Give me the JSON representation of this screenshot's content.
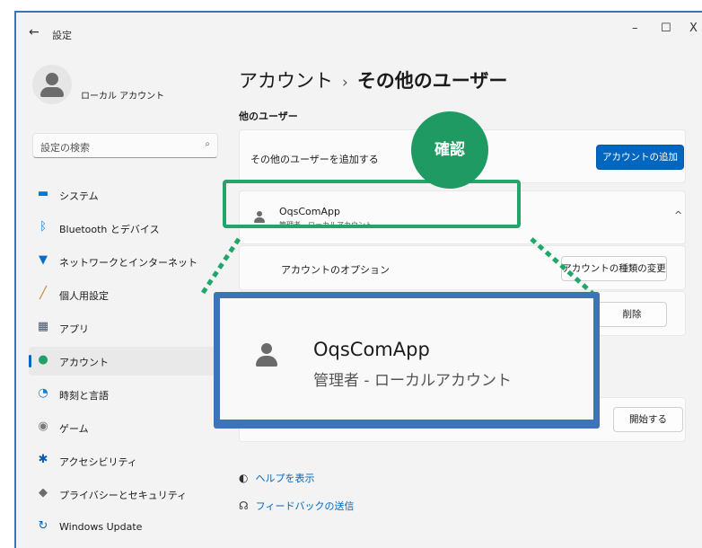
{
  "window": {
    "back_glyph": "←",
    "title": "設定",
    "minimize_glyph": "–",
    "maximize_glyph": "☐",
    "close_glyph": "X"
  },
  "user": {
    "name": "ローカル アカウント",
    "avatar_icon": "person-icon"
  },
  "search": {
    "placeholder": "設定の検索",
    "icon": "search-icon",
    "icon_glyph": "⌕"
  },
  "sidebar": {
    "items": [
      {
        "label": "システム",
        "icon": "monitor-icon",
        "glyph": "▬",
        "color": "#0078d4"
      },
      {
        "label": "Bluetooth とデバイス",
        "icon": "bluetooth-icon",
        "glyph": "ᛒ",
        "color": "#0078d4"
      },
      {
        "label": "ネットワークとインターネット",
        "icon": "wifi-icon",
        "glyph": "▼",
        "color": "#0a6cc2"
      },
      {
        "label": "個人用設定",
        "icon": "brush-icon",
        "glyph": "╱",
        "color": "#c47a2c"
      },
      {
        "label": "アプリ",
        "icon": "apps-icon",
        "glyph": "▦",
        "color": "#44546a"
      },
      {
        "label": "アカウント",
        "icon": "account-icon",
        "glyph": "●",
        "color": "#22a06b",
        "active": true
      },
      {
        "label": "時刻と言語",
        "icon": "globe-clock-icon",
        "glyph": "◔",
        "color": "#1c7ad6"
      },
      {
        "label": "ゲーム",
        "icon": "gamepad-icon",
        "glyph": "◉",
        "color": "#7a7a7a"
      },
      {
        "label": "アクセシビリティ",
        "icon": "accessibility-icon",
        "glyph": "✱",
        "color": "#0b5cad"
      },
      {
        "label": "プライバシーとセキュリティ",
        "icon": "shield-icon",
        "glyph": "◆",
        "color": "#6b6b6b"
      },
      {
        "label": "Windows Update",
        "icon": "update-icon",
        "glyph": "↻",
        "color": "#0067c0"
      }
    ]
  },
  "main": {
    "breadcrumb_parent": "アカウント",
    "breadcrumb_sep": "›",
    "breadcrumb_current": "その他のユーザー",
    "section_title": "他のユーザー",
    "add_user_label": "その他のユーザーを追加する",
    "add_account_button": "アカウントの追加",
    "user_entry": {
      "name": "OqsComApp",
      "subtitle": "管理者 - ローカルアカウント",
      "chevron": "^"
    },
    "options_label": "アカウントのオプション",
    "change_type_button": "アカウントの種類の変更",
    "remove_button": "削除",
    "start_button": "開始する"
  },
  "annotation": {
    "badge_text": "確認",
    "zoom_name": "OqsComApp",
    "zoom_subtitle": "管理者 - ローカルアカウント",
    "accent_green": "#22a56b",
    "accent_blue": "#3d73b8"
  },
  "footer_links": [
    {
      "label": "ヘルプを表示",
      "icon": "help-icon",
      "glyph": "◐"
    },
    {
      "label": "フィードバックの送信",
      "icon": "feedback-icon",
      "glyph": "☊"
    }
  ]
}
